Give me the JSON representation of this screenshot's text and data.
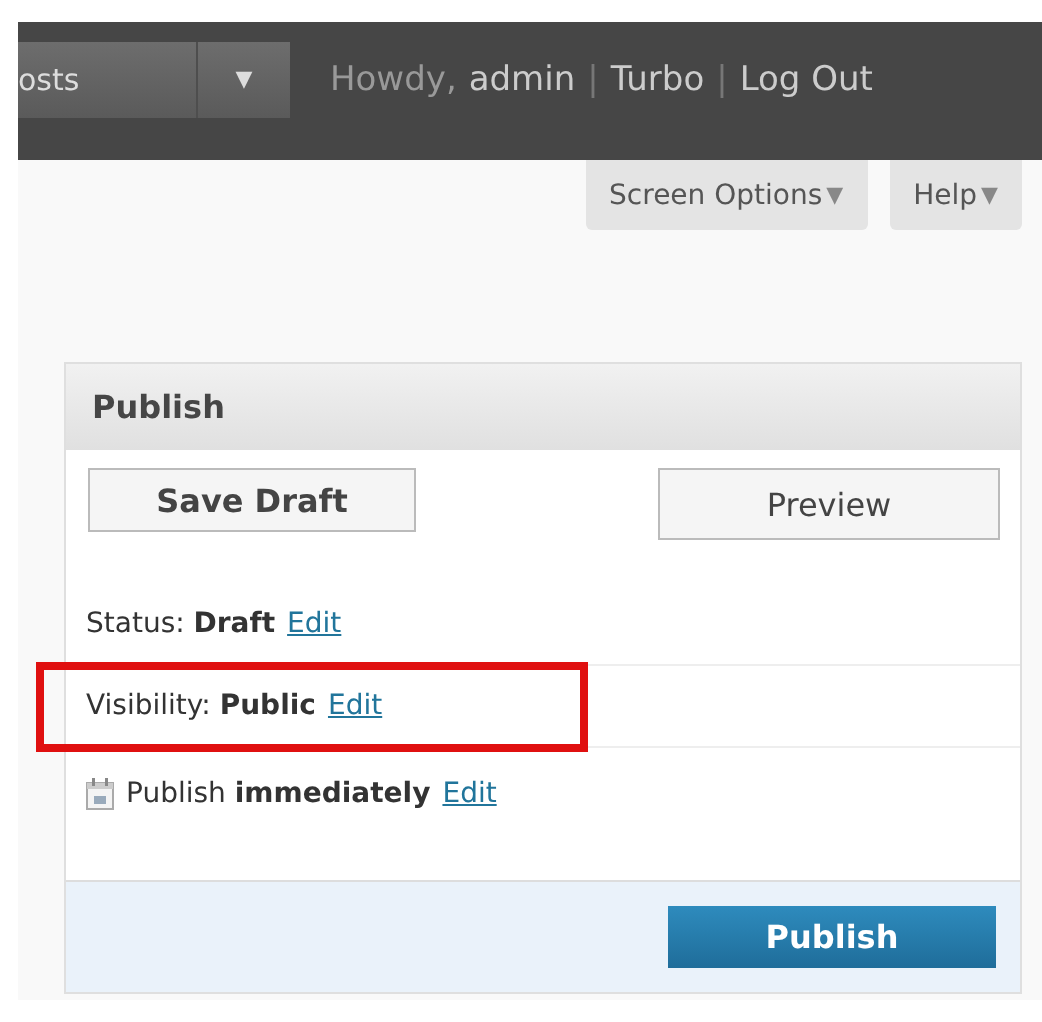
{
  "admin_bar": {
    "menu": "osts",
    "menu_arrow": "▼",
    "greeting": "Howdy,",
    "user": "admin",
    "separator": "|",
    "links": [
      "Turbo",
      "Log Out"
    ]
  },
  "screen_tabs": [
    {
      "label": "Screen Options",
      "arrow": "▼"
    },
    {
      "label": "Help",
      "arrow": "▼"
    }
  ],
  "publish_box": {
    "title": "Publish",
    "save_draft": "Save Draft",
    "preview": "Preview",
    "rows": [
      {
        "kind": "status",
        "label": "Status:",
        "value": "Draft",
        "link": "Edit",
        "highlighted": false
      },
      {
        "kind": "visibility",
        "label": "Visibility:",
        "value": "Public",
        "link": "Edit",
        "highlighted": true
      },
      {
        "kind": "schedule",
        "label": "Publish",
        "value": "immediately",
        "link": "Edit",
        "highlighted": false
      }
    ],
    "publish_button": "Publish"
  }
}
